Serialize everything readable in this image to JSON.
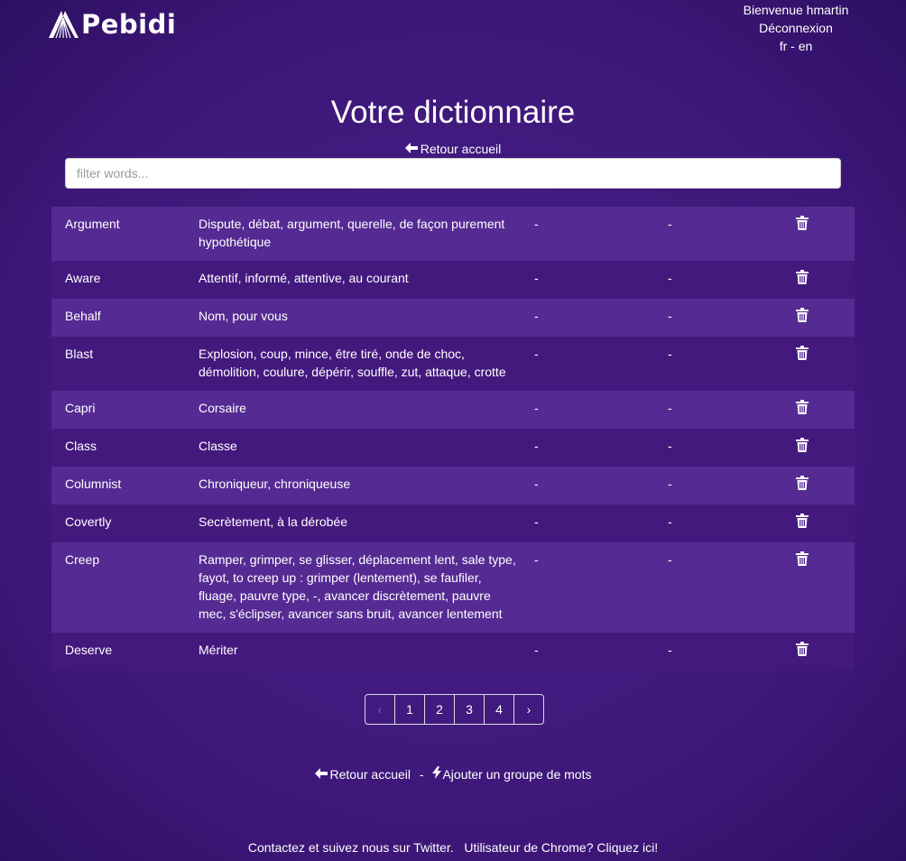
{
  "header": {
    "logo_text": "Pebidi",
    "welcome": "Bienvenue hmartin",
    "logout": "Déconnexion",
    "lang_fr": "fr",
    "lang_sep": "-",
    "lang_en": "en"
  },
  "page": {
    "title": "Votre dictionnaire",
    "back_home": "Retour accueil",
    "filter_placeholder": "filter words..."
  },
  "words": [
    {
      "word": "Argument",
      "translation": "Dispute, débat, argument, querelle, de façon purement hypothétique",
      "col3": "-",
      "col4": "-"
    },
    {
      "word": "Aware",
      "translation": "Attentif, informé, attentive, au courant",
      "col3": "-",
      "col4": "-"
    },
    {
      "word": "Behalf",
      "translation": "Nom, pour vous",
      "col3": "-",
      "col4": "-"
    },
    {
      "word": "Blast",
      "translation": "Explosion, coup, mince, être tiré, onde de choc, démolition, coulure, dépérir, souffle, zut, attaque, crotte",
      "col3": "-",
      "col4": "-"
    },
    {
      "word": "Capri",
      "translation": "Corsaire",
      "col3": "-",
      "col4": "-"
    },
    {
      "word": "Class",
      "translation": "Classe",
      "col3": "-",
      "col4": "-"
    },
    {
      "word": "Columnist",
      "translation": "Chroniqueur, chroniqueuse",
      "col3": "-",
      "col4": "-"
    },
    {
      "word": "Covertly",
      "translation": "Secrètement, à la dérobée",
      "col3": "-",
      "col4": "-"
    },
    {
      "word": "Creep",
      "translation": "Ramper, grimper, se glisser, déplacement lent, sale type, fayot, to creep up : grimper (lentement), se faufiler, fluage, pauvre type, -, avancer discrètement, pauvre mec, s'éclipser, avancer sans bruit, avancer lentement",
      "col3": "-",
      "col4": "-"
    },
    {
      "word": "Deserve",
      "translation": "Mériter",
      "col3": "-",
      "col4": "-"
    }
  ],
  "pagination": {
    "prev": "‹",
    "pages": [
      "1",
      "2",
      "3",
      "4"
    ],
    "next": "›"
  },
  "footer": {
    "back_home": "Retour accueil",
    "separator": "-",
    "add_group": "Ajouter un groupe de mots",
    "contact": "Contactez et suivez nous sur Twitter.",
    "chrome": "Utilisateur de Chrome? Cliquez ici!"
  },
  "icons": {
    "logo": "pebidi-logo-icon",
    "back": "arrow-left-icon",
    "delete": "trash-icon",
    "add": "bolt-icon"
  }
}
